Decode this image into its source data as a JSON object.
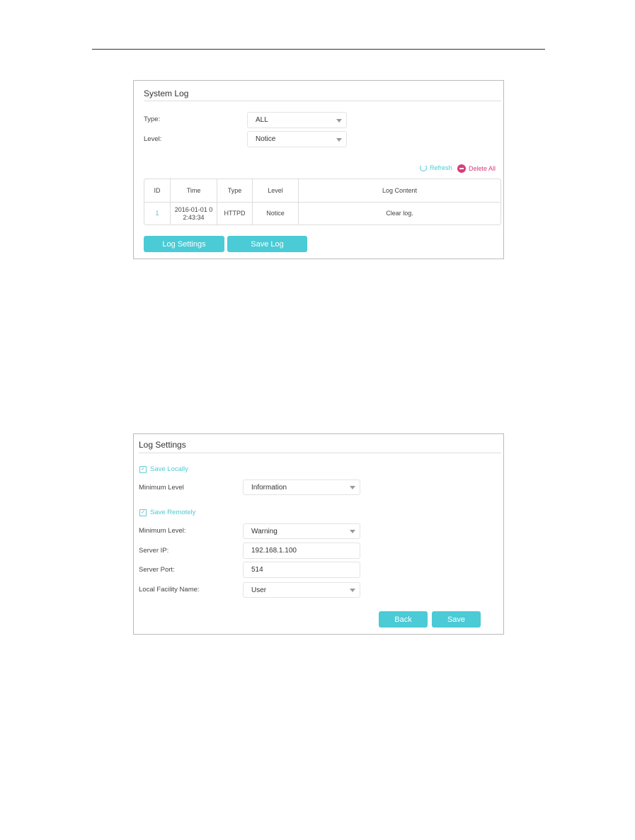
{
  "system_log": {
    "title": "System Log",
    "type_label": "Type:",
    "type_value": "ALL",
    "level_label": "Level:",
    "level_value": "Notice",
    "refresh_label": "Refresh",
    "delete_all_label": "Delete All",
    "columns": [
      "ID",
      "Time",
      "Type",
      "Level",
      "Log Content"
    ],
    "rows": [
      {
        "id": "1",
        "time": "2016-01-01 0 2:43:34",
        "type": "HTTPD",
        "level": "Notice",
        "content": "Clear log."
      }
    ],
    "log_settings_button": "Log Settings",
    "save_log_button": "Save Log"
  },
  "log_settings": {
    "title": "Log Settings",
    "save_locally_label": "Save Locally",
    "save_locally_checked": true,
    "local_min_level_label": "Minimum Level",
    "local_min_level_value": "Information",
    "save_remotely_label": "Save Remotely",
    "save_remotely_checked": true,
    "remote_min_level_label": "Minimum Level:",
    "remote_min_level_value": "Warning",
    "server_ip_label": "Server IP:",
    "server_ip_value": "192.168.1.100",
    "server_port_label": "Server Port:",
    "server_port_value": "514",
    "facility_label": "Local Facility Name:",
    "facility_value": "User",
    "back_button": "Back",
    "save_button": "Save"
  },
  "colors": {
    "accent": "#4acbd6",
    "delete": "#d83d7a"
  }
}
